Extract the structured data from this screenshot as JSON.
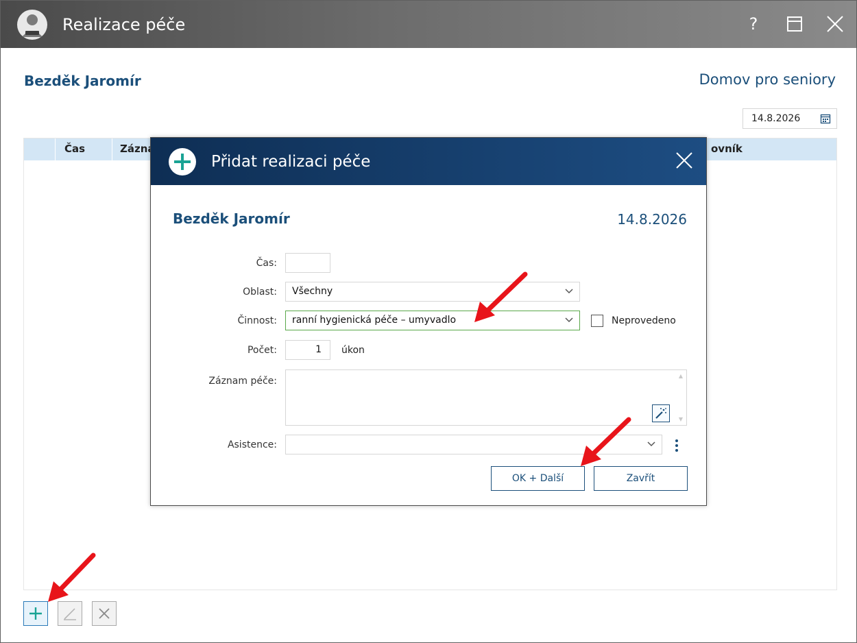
{
  "window": {
    "title": "Realizace péče",
    "help_label": "?",
    "maximize_icon": "maximize-icon",
    "close_icon": "close-icon"
  },
  "header": {
    "patient_name": "Bezděk Jaromír",
    "facility": "Domov pro seniory",
    "date": "14.8.2026"
  },
  "grid": {
    "columns": [
      "Čas",
      "Zázna",
      "ovník"
    ]
  },
  "toolbar": {
    "add_icon": "plus-icon",
    "edit_icon": "edit-icon",
    "delete_icon": "delete-icon"
  },
  "dialog": {
    "title": "Přidat realizaci péče",
    "patient_name": "Bezděk Jaromír",
    "date": "14.8.2026",
    "fields": {
      "time_label": "Čas:",
      "time_value": "",
      "area_label": "Oblast:",
      "area_value": "Všechny",
      "activity_label": "Činnost:",
      "activity_value": "ranní hygienická péče – umyvadlo",
      "not_done_label": "Neprovedeno",
      "count_label": "Počet:",
      "count_value": "1",
      "count_unit": "úkon",
      "record_label": "Záznam péče:",
      "record_value": "",
      "assist_label": "Asistence:",
      "assist_value": ""
    },
    "buttons": {
      "ok_next": "OK + Další",
      "close": "Zavřít"
    }
  },
  "colors": {
    "accent": "#1b4f7a",
    "header_row": "#d3e6f5",
    "active_border": "#5aa84a",
    "plus_green": "#1aa394",
    "annotation_arrow": "#e8141a"
  }
}
